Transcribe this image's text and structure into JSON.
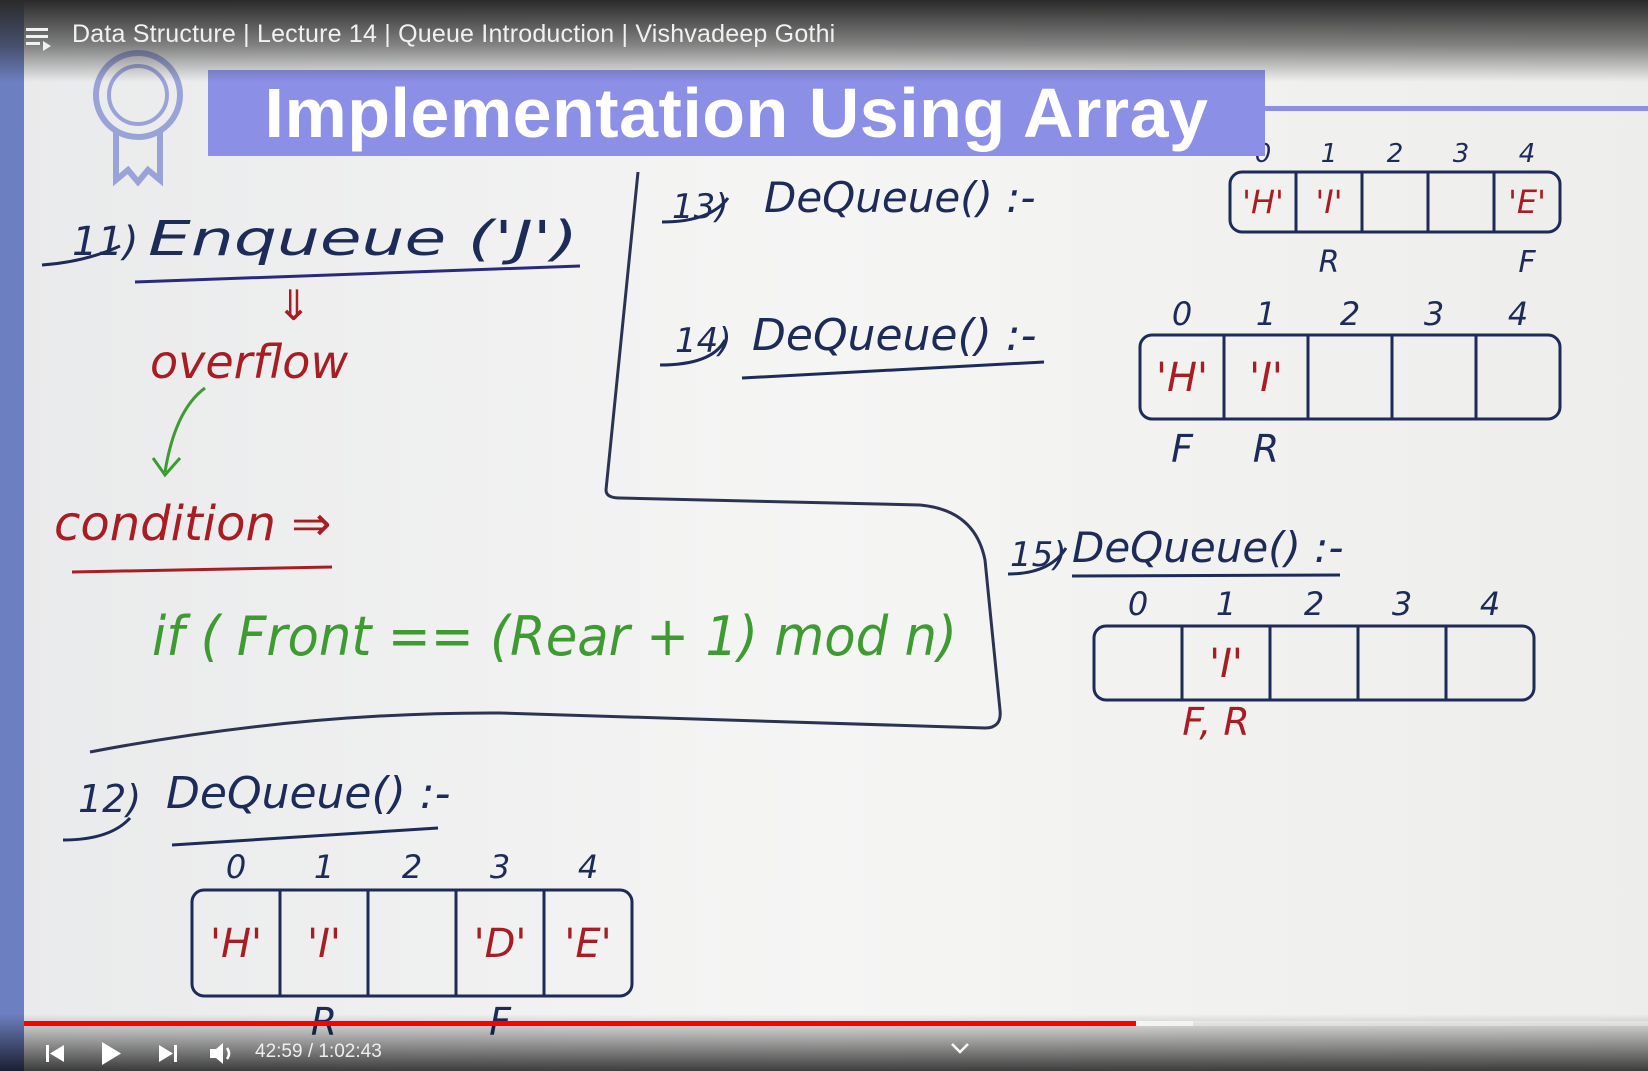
{
  "video": {
    "title": "Data Structure | Lecture 14 | Queue Introduction | Vishvadeep Gothi",
    "current_time": "42:59",
    "duration": "1:02:43",
    "time_display": "42:59 / 1:02:43",
    "progress_fraction": 0.685,
    "buffered_fraction": 0.72
  },
  "slide": {
    "heading": "Implementation Using Array",
    "step11": {
      "number": "11)",
      "text": "Enqueue ('J')",
      "arrow": "⇓",
      "result": "overflow",
      "condition_label": "condition ⇒",
      "condition": "if ( Front == (Rear + 1) mod n)"
    },
    "step12": {
      "number": "12)",
      "text": "DeQueue() :-",
      "indices": [
        "0",
        "1",
        "2",
        "3",
        "4"
      ],
      "cells": [
        "'H'",
        "'I'",
        "",
        "'D'",
        "'E'"
      ],
      "pointers": [
        {
          "label": "R",
          "index": 1
        },
        {
          "label": "F",
          "index": 3
        }
      ]
    },
    "step13": {
      "number": "13)",
      "text": "DeQueue() :-",
      "indices": [
        "0",
        "1",
        "2",
        "3",
        "4"
      ],
      "cells": [
        "'H'",
        "'I'",
        "",
        "",
        "'E'"
      ],
      "pointers": [
        {
          "label": "R",
          "index": 1
        },
        {
          "label": "F",
          "index": 4
        }
      ]
    },
    "step14": {
      "number": "14)",
      "text": "DeQueue() :-",
      "indices": [
        "0",
        "1",
        "2",
        "3",
        "4"
      ],
      "cells": [
        "'H'",
        "'I'",
        "",
        "",
        ""
      ],
      "pointers": [
        {
          "label": "F",
          "index": 0
        },
        {
          "label": "R",
          "index": 1
        }
      ]
    },
    "step15": {
      "number": "15)",
      "text": "DeQueue() :-",
      "indices": [
        "0",
        "1",
        "2",
        "3",
        "4"
      ],
      "cells": [
        "",
        "'I'",
        "",
        "",
        ""
      ],
      "pointer_label": "F, R"
    }
  },
  "colors": {
    "ink_blue": "#1c2b57",
    "ink_red": "#a81d24",
    "ink_green": "#3e9b32",
    "banner": "#8c8fe6",
    "progress": "#ff0000"
  },
  "icons": {
    "menu": "playlist-menu-icon",
    "badge": "award-badge-icon",
    "previous": "skip-previous-icon",
    "play": "play-icon",
    "next": "skip-next-icon",
    "volume": "volume-icon",
    "expand": "chevron-down-icon"
  }
}
